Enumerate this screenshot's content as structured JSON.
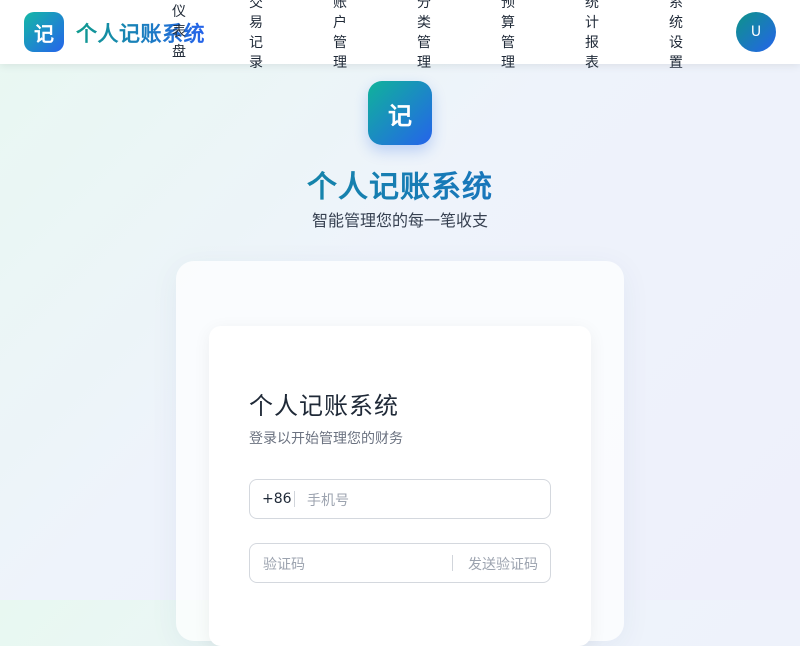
{
  "header": {
    "logo_glyph": "记",
    "app_name": "个人记账系统",
    "nav": [
      "仪表盘",
      "交易记录",
      "账户管理",
      "分类管理",
      "预算管理",
      "统计报表",
      "系统设置"
    ],
    "avatar_letter": "U"
  },
  "hero": {
    "logo_glyph": "记",
    "title": "个人记账系统",
    "subtitle": "智能管理您的每一笔收支"
  },
  "login": {
    "title": "个人记账系统",
    "subtitle": "登录以开始管理您的财务",
    "phone_prefix": "+86",
    "phone_placeholder": "手机号",
    "code_placeholder": "验证码",
    "send_code_label": "发送验证码"
  },
  "colors": {
    "brand_start": "#14b8a6",
    "brand_end": "#2563eb"
  }
}
